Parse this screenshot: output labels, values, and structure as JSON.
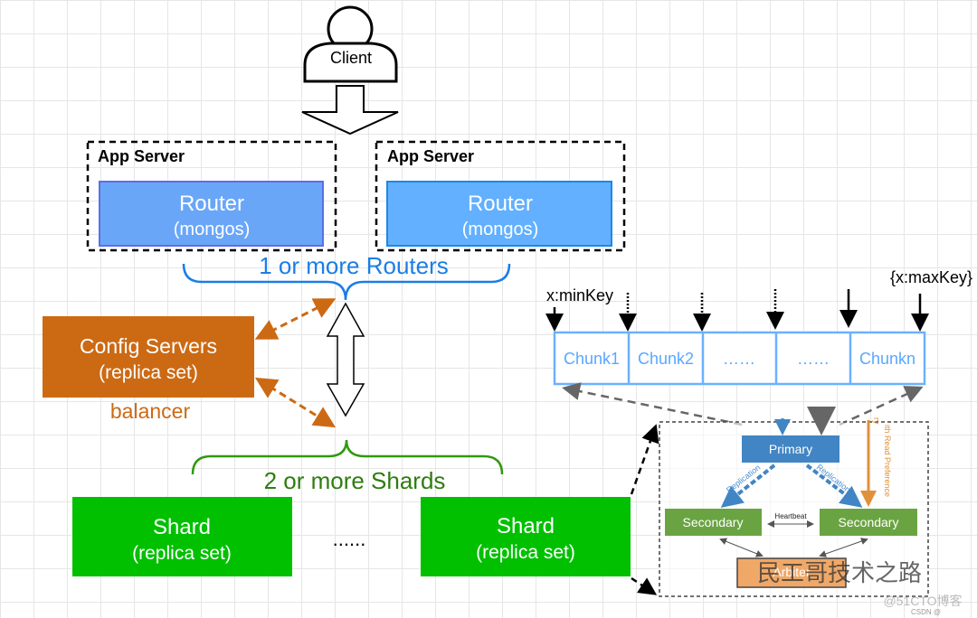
{
  "client": {
    "label": "Client"
  },
  "app_servers": [
    {
      "label": "App Server",
      "router": "Router",
      "router_sub": "(mongos)"
    },
    {
      "label": "App Server",
      "router": "Router",
      "router_sub": "(mongos)"
    }
  ],
  "routers_brace": "1 or more Routers",
  "config": {
    "title": "Config Servers",
    "sub": "(replica set)",
    "balancer": "balancer"
  },
  "shards_brace": "2 or more Shards",
  "shards": [
    {
      "title": "Shard",
      "sub": "(replica set)"
    },
    {
      "title": "Shard",
      "sub": "(replica set)"
    }
  ],
  "shards_ellipsis": "......",
  "chunks": {
    "min_label": "x:minKey",
    "max_label": "{x:maxKey}",
    "items": [
      "Chunk1",
      "Chunk2",
      "……",
      "……",
      "Chunkn"
    ]
  },
  "replica": {
    "primary": "Primary",
    "secondary_left": "Secondary",
    "secondary_right": "Secondary",
    "heartbeat": "Heartbeat",
    "replication": "Replication",
    "read_pref": "ith Read Preference",
    "read_pref2": "ry",
    "arbiter": "Arbiter"
  },
  "watermarks": {
    "main": "民工哥技术之路",
    "site": "@51CTO博客",
    "csdn": "CSDN @"
  },
  "colors": {
    "router_fill": "#66aaff",
    "config_fill": "#cc6a14",
    "shard_fill": "#00c000",
    "routers_text": "#1a7ee6",
    "shards_text": "#2e7d0e",
    "balancer": "#cc6a14",
    "chunk_border": "#6bb1ff",
    "primary": "#4285c4",
    "secondary": "#6aa442",
    "arbiter": "#f0a868"
  }
}
